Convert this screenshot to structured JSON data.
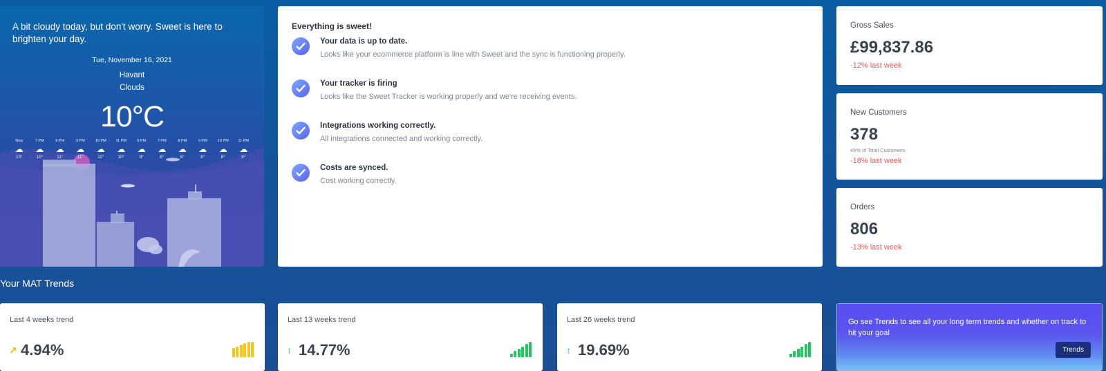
{
  "weather": {
    "message": "A bit cloudy today, but don't worry. Sweet is here to brighten your day.",
    "date": "Tue, November 16, 2021",
    "city": "Havant",
    "condition": "Clouds",
    "temperature": "10°C",
    "cloud_icon": "cloud-icon",
    "hourly": [
      {
        "time": "Now",
        "temp": "10°"
      },
      {
        "time": "7 PM",
        "temp": "10°"
      },
      {
        "time": "8 PM",
        "temp": "11°"
      },
      {
        "time": "9 PM",
        "temp": "11°"
      },
      {
        "time": "10 PM",
        "temp": "11°"
      },
      {
        "time": "11 PM",
        "temp": "10°"
      },
      {
        "time": "6 PM",
        "temp": "8°"
      },
      {
        "time": "7 PM",
        "temp": "8°"
      },
      {
        "time": "8 PM",
        "temp": "8°"
      },
      {
        "time": "9 PM",
        "temp": "8°"
      },
      {
        "time": "10 PM",
        "temp": "8°"
      },
      {
        "time": "11 PM",
        "temp": "9°"
      }
    ]
  },
  "status": {
    "title": "Everything is sweet!",
    "check_icon": "check-circle-icon",
    "items": [
      {
        "title": "Your data is up to date.",
        "description": "Looks like your ecommerce platform is line with Sweet and the sync is functioning properly."
      },
      {
        "title": "Your tracker is firing",
        "description": "Looks like the Sweet Tracker is working properly and we're receiving events."
      },
      {
        "title": "Integrations working correctly.",
        "description": "All integrations connected and working correctly."
      },
      {
        "title": "Costs are synced.",
        "description": "Cost working correctly."
      }
    ]
  },
  "kpis": {
    "gross_sales": {
      "label": "Gross Sales",
      "value": "£99,837.86",
      "change": "-12% last week"
    },
    "new_customers": {
      "label": "New Customers",
      "value": "378",
      "sub": "49% of Total Customers",
      "change": "-18% last week"
    },
    "orders": {
      "label": "Orders",
      "value": "806",
      "change": "-13% last week"
    }
  },
  "trends": {
    "title": "Your MAT Trends",
    "items": [
      {
        "label": "Last 4 weeks trend",
        "value": "4.94%",
        "arrow": "↗",
        "arrow_color": "#f5b400",
        "bar_color": "#f5c518",
        "bar_levels": [
          0.6,
          0.7,
          0.8,
          0.9,
          1.0,
          1.0
        ]
      },
      {
        "label": "Last 13 weeks trend",
        "value": "14.77%",
        "arrow": "↑",
        "arrow_color": "#2ecc71",
        "bar_color": "#22c55e",
        "bar_levels": [
          0.25,
          0.4,
          0.55,
          0.7,
          0.85,
          1.0
        ]
      },
      {
        "label": "Last 26 weeks trend",
        "value": "19.69%",
        "arrow": "↑",
        "arrow_color": "#2ecc71",
        "bar_color": "#22c55e",
        "bar_levels": [
          0.25,
          0.4,
          0.55,
          0.7,
          0.85,
          1.0
        ]
      }
    ]
  },
  "promo": {
    "text": "Go see Trends to see all your long term trends and whether on track to hit your goal",
    "button": "Trends"
  },
  "colors": {
    "accent": "#5a63f0",
    "negative": "#ee5a5a",
    "positive": "#22c55e",
    "warning": "#f5c518"
  }
}
